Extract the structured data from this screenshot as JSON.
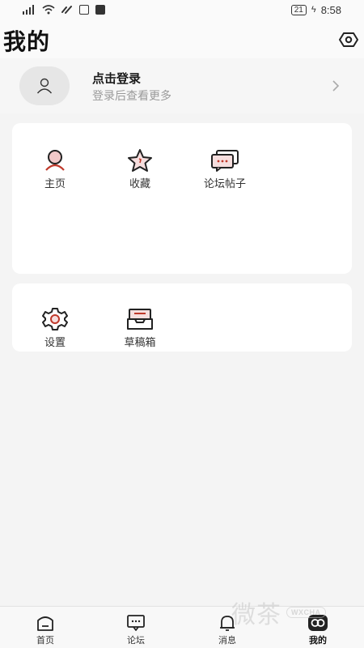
{
  "status_bar": {
    "battery": "21",
    "time": "8:58"
  },
  "header": {
    "title": "我的"
  },
  "login": {
    "title": "点击登录",
    "subtitle": "登录后查看更多"
  },
  "grid_main": {
    "items": [
      {
        "label": "主页",
        "icon": "user-icon"
      },
      {
        "label": "收藏",
        "icon": "star-icon"
      },
      {
        "label": "论坛帖子",
        "icon": "chat-bubbles-icon"
      }
    ]
  },
  "grid_tools": {
    "items": [
      {
        "label": "设置",
        "icon": "gear-icon"
      },
      {
        "label": "草稿箱",
        "icon": "inbox-icon"
      }
    ]
  },
  "bottom_nav": {
    "items": [
      {
        "label": "首页",
        "icon": "home-icon"
      },
      {
        "label": "论坛",
        "icon": "forum-icon"
      },
      {
        "label": "消息",
        "icon": "bell-icon"
      },
      {
        "label": "我的",
        "icon": "profile-icon",
        "active": true
      }
    ]
  },
  "watermark": {
    "text": "微茶",
    "badge": "WXCHA"
  },
  "colors": {
    "accent_red": "#c0392b",
    "icon_stroke": "#222222"
  }
}
